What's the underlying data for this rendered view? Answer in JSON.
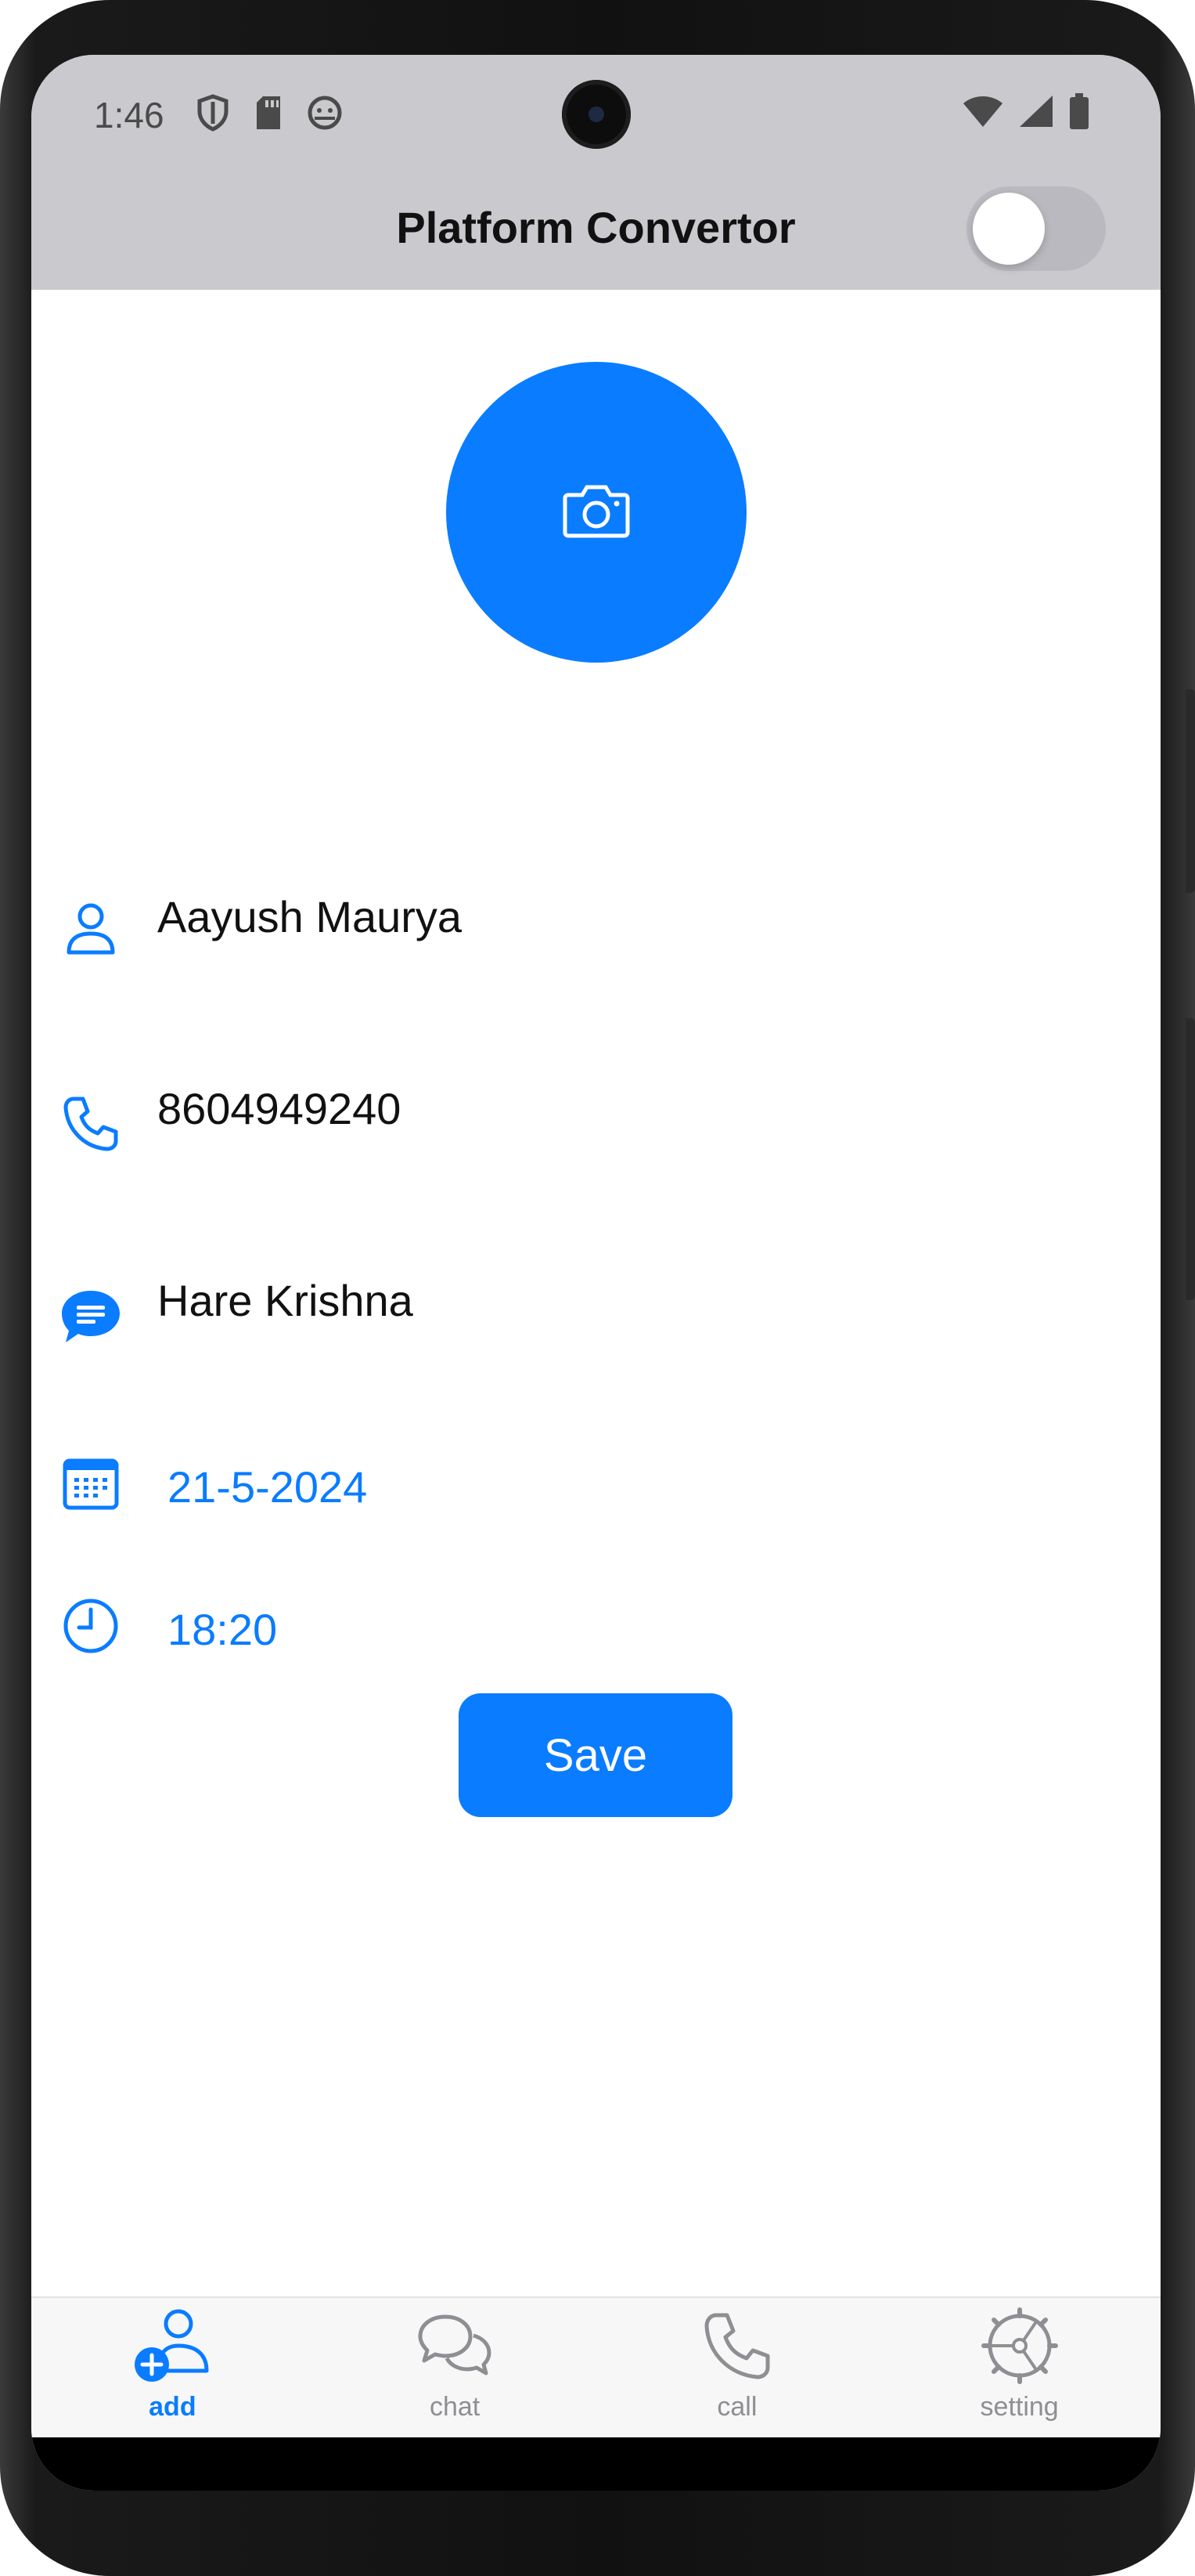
{
  "status_bar": {
    "time": "1:46",
    "left_icons": [
      "shield-icon",
      "sd-card-icon",
      "android-debug-icon"
    ],
    "right_icons": [
      "wifi-icon",
      "cell-signal-icon",
      "battery-icon"
    ]
  },
  "app_bar": {
    "title": "Platform Convertor",
    "toggle_on": false
  },
  "avatar": {
    "icon": "camera-icon",
    "color": "#0a7cff"
  },
  "form": {
    "name": {
      "icon": "person-icon",
      "value": "Aayush Maurya"
    },
    "phone": {
      "icon": "phone-icon",
      "value": "8604949240"
    },
    "message": {
      "icon": "chat-bubble-icon",
      "value": "Hare Krishna"
    },
    "date": {
      "icon": "calendar-icon",
      "value": "21-5-2024"
    },
    "time": {
      "icon": "clock-icon",
      "value": "18:20"
    }
  },
  "save_label": "Save",
  "bottom_nav": {
    "items": [
      {
        "label": "add",
        "icon": "add-person-icon",
        "active": true
      },
      {
        "label": "chat",
        "icon": "chat-icon",
        "active": false
      },
      {
        "label": "call",
        "icon": "phone-icon",
        "active": false
      },
      {
        "label": "setting",
        "icon": "settings-icon",
        "active": false
      }
    ]
  },
  "colors": {
    "accent": "#0a7cff",
    "header_bg": "#c9c9ce",
    "inactive": "#8e8e93"
  }
}
